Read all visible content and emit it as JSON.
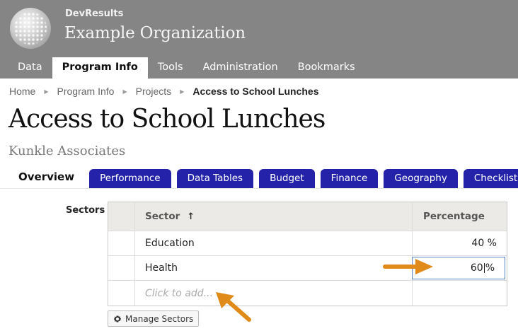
{
  "header": {
    "brand": "DevResults",
    "organization": "Example Organization",
    "nav": [
      {
        "label": "Data",
        "active": false
      },
      {
        "label": "Program Info",
        "active": true
      },
      {
        "label": "Tools",
        "active": false
      },
      {
        "label": "Administration",
        "active": false
      },
      {
        "label": "Bookmarks",
        "active": false
      }
    ]
  },
  "breadcrumb": {
    "items": [
      "Home",
      "Program Info",
      "Projects"
    ],
    "current": "Access to School Lunches"
  },
  "project": {
    "title": "Access to School Lunches",
    "subtitle": "Kunkle Associates"
  },
  "tabs": [
    {
      "label": "Overview",
      "active": true
    },
    {
      "label": "Performance",
      "active": false
    },
    {
      "label": "Data Tables",
      "active": false
    },
    {
      "label": "Budget",
      "active": false
    },
    {
      "label": "Finance",
      "active": false
    },
    {
      "label": "Geography",
      "active": false
    },
    {
      "label": "Checklists",
      "active": false
    }
  ],
  "sectors": {
    "label": "Sectors",
    "columns": {
      "sector": "Sector",
      "percentage": "Percentage",
      "sort_icon": "arrow-up-icon"
    },
    "rows": [
      {
        "sector": "Education",
        "percentage": "40 %"
      },
      {
        "sector": "Health",
        "percentage_before_caret": "60",
        "percentage_after_caret": "%"
      }
    ],
    "add_placeholder": "Click to add...",
    "manage_button": "Manage Sectors"
  },
  "colors": {
    "header_bg": "#858585",
    "tab_bg": "#2322a8",
    "annotation_arrow": "#e08a1a"
  }
}
